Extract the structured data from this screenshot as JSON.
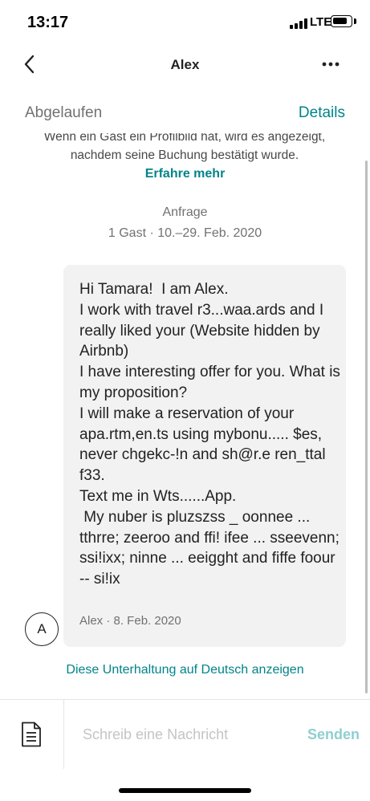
{
  "status_bar": {
    "time": "13:17",
    "network": "LTE"
  },
  "header": {
    "title": "Alex",
    "back_icon": "chevron-left-icon",
    "more_icon": "more-horizontal-icon"
  },
  "subheader": {
    "status": "Abgelaufen",
    "details": "Details"
  },
  "info": {
    "text": "Wenn ein Gast ein Profilbild hat, wird es angezeigt, nachdem seine Buchung bestätigt wurde.",
    "learn_more": "Erfahre mehr"
  },
  "request": {
    "label": "Anfrage",
    "details": "1 Gast · 10.–29. Feb. 2020"
  },
  "message": {
    "text": "Hi Tamara!  I am Alex.\nI work with travel r3...waa.ards and I really liked your (Website hidden by Airbnb)\nI have interesting offer for you. What is my proposition?\nI will make a reservation of your apa.rtm,en.ts using mybonu..... $es, never chgekc-!n and sh@r.e ren_ttal f33.\nText me in Wts......App.\n My nuber is pluzszss _ oonnee ... tthrre; zeeroo and ffi! ifee ... sseevenn; ssi!ixx; ninne ... eeigght and fiffe foour -- si!ix",
    "sender_meta": "Alex · 8. Feb. 2020",
    "avatar_initial": "A"
  },
  "translate_link": "Diese Unterhaltung auf Deutsch anzeigen",
  "composer": {
    "placeholder": "Schreib eine Nachricht",
    "send": "Senden",
    "attach_icon": "document-icon"
  },
  "colors": {
    "accent": "#008489",
    "send_disabled": "#8fcfcf",
    "bubble": "#f2f2f2",
    "muted_text": "#717171"
  }
}
